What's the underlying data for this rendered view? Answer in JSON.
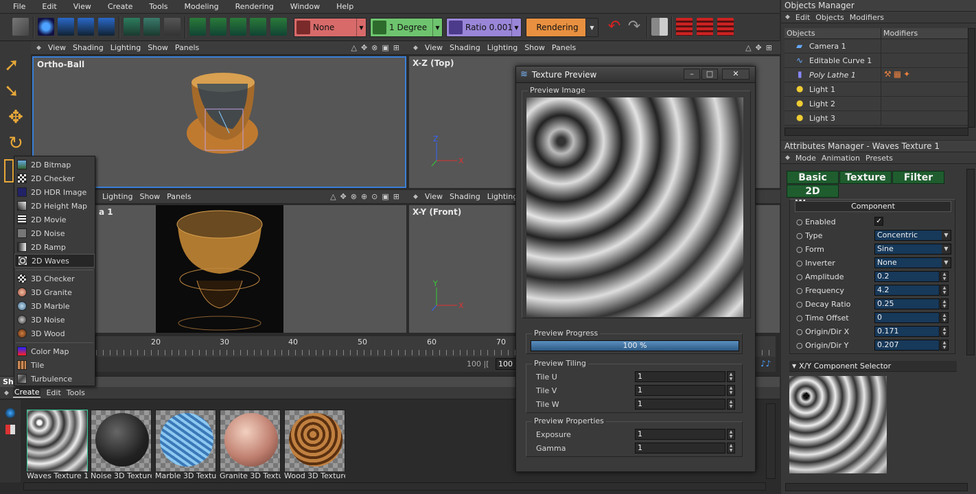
{
  "menubar": [
    "File",
    "Edit",
    "View",
    "Create",
    "Tools",
    "Modeling",
    "Rendering",
    "Window",
    "Help"
  ],
  "toolbar": {
    "combo_none": "None",
    "combo_degree": "1 Degree",
    "combo_ratio": "Ratio 0.001",
    "combo_rendering": "Rendering"
  },
  "viewport_menu": [
    "View",
    "Shading",
    "Lighting",
    "Show",
    "Panels"
  ],
  "viewport_menu_partial": [
    "Lighting",
    "Show",
    "Panels"
  ],
  "viewport_menu_right_partial": [
    "View",
    "Shading",
    "Lighting",
    "S"
  ],
  "viewports": {
    "tl_label": "Ortho-Ball",
    "tr_label": "X-Z (Top)",
    "bl_label": "a 1",
    "br_label": "X-Y (Front)"
  },
  "context_menu": [
    "2D Bitmap",
    "2D Checker",
    "2D HDR Image",
    "2D Height Map",
    "2D Movie",
    "2D Noise",
    "2D Ramp",
    "2D Waves",
    "3D Checker",
    "3D Granite",
    "3D Marble",
    "3D Noise",
    "3D Wood",
    "Color Map",
    "Tile",
    "Turbulence"
  ],
  "context_menu_selected": "2D Waves",
  "timeline": {
    "ticks": [
      "20",
      "30",
      "40",
      "50",
      "60",
      "70"
    ],
    "end_field": "100",
    "end_display": "100 |["
  },
  "bottom_panel": {
    "tab_stub": "Sh",
    "menu": [
      "Create",
      "Edit",
      "Tools"
    ]
  },
  "materials": [
    "Waves Texture 1",
    "Noise 3D Texture",
    "Marble 3D Textur",
    "Granite 3D Textu",
    "Wood 3D Texture"
  ],
  "texture_preview": {
    "title": "Texture Preview",
    "preview_image": "Preview Image",
    "progress_group": "Preview Progress",
    "progress_value": 100,
    "progress_text": "100 %",
    "tiling_group": "Preview Tiling",
    "tiling": [
      {
        "label": "Tile U",
        "value": "1"
      },
      {
        "label": "Tile V",
        "value": "1"
      },
      {
        "label": "Tile W",
        "value": "1"
      }
    ],
    "props_group": "Preview Properties",
    "props": [
      {
        "label": "Exposure",
        "value": "1"
      },
      {
        "label": "Gamma",
        "value": "1"
      }
    ]
  },
  "objects_manager": {
    "title": "Objects Manager",
    "menu": [
      "Edit",
      "Objects",
      "Modifiers"
    ],
    "col_objects": "Objects",
    "col_modifiers": "Modifiers",
    "objects": [
      "Camera 1",
      "Editable Curve 1",
      "Poly Lathe 1",
      "Light 1",
      "Light 2",
      "Light 3"
    ]
  },
  "attributes_manager": {
    "title": "Attributes Manager - Waves Texture 1",
    "menu": [
      "Mode",
      "Animation",
      "Presets"
    ],
    "tabs": [
      "Basic",
      "Texture",
      "Filter",
      "2D Waves"
    ],
    "section": "Component",
    "enabled_label": "Enabled",
    "type": {
      "label": "Type",
      "value": "Concentric"
    },
    "form": {
      "label": "Form",
      "value": "Sine"
    },
    "inverter": {
      "label": "Inverter",
      "value": "None"
    },
    "fields": [
      {
        "label": "Amplitude",
        "value": "0.2"
      },
      {
        "label": "Frequency",
        "value": "4.2"
      },
      {
        "label": "Decay Ratio",
        "value": "0.25"
      },
      {
        "label": "Time Offset",
        "value": "0"
      },
      {
        "label": "Origin/Dir X",
        "value": "0.171"
      },
      {
        "label": "Origin/Dir Y",
        "value": "0.207"
      }
    ],
    "selector_title": "X/Y Component Selector"
  },
  "colors": {
    "accent": "#1f5d2f",
    "field": "#17395a",
    "progress": "#3e6f99",
    "orange": "#e89040"
  }
}
